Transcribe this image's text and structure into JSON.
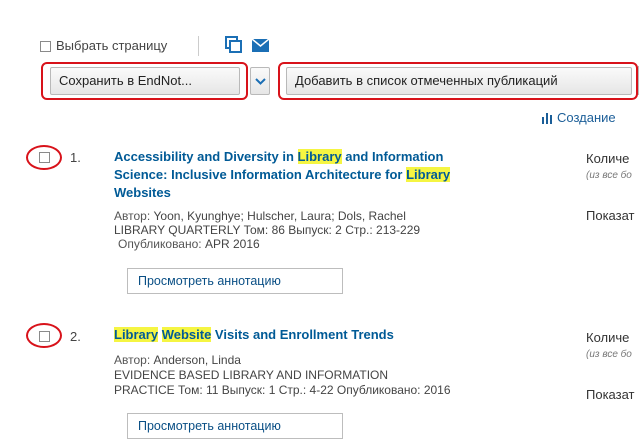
{
  "toolbar": {
    "select_page": "Выбрать страницу",
    "save_label": "Сохранить в EndNot...",
    "add_marked_label": "Добавить в список отмеченных публикаций",
    "create_label": "Создание",
    "icons": [
      "print-icon",
      "email-icon",
      "chevron-down-icon",
      "bar-chart-icon"
    ]
  },
  "results": [
    {
      "index": "1.",
      "title_parts": [
        {
          "t": "Accessibility and Diversity in ",
          "hl": false
        },
        {
          "t": "Library",
          "hl": true
        },
        {
          "t": " and Information",
          "hl": false
        }
      ],
      "title_line2": [
        {
          "t": "Science: Inclusive Information Architecture for ",
          "hl": false
        },
        {
          "t": "Library",
          "hl": true
        }
      ],
      "title_line3": "Websites",
      "authors_label": "Автор:",
      "authors": "Yoon, Kyunghye; Hulscher, Laura; Dols, Rachel",
      "source_line": "LIBRARY QUARTERLY  Том: 86  Выпуск: 2  Стр.: 213-229",
      "published_label": "Опубликовано:",
      "published": "APR 2016",
      "abstract_button": "Просмотреть аннотацию",
      "side_count": "Количе",
      "side_note": "(из все бо",
      "side_show": "Показат"
    },
    {
      "index": "2.",
      "title_parts": [
        {
          "t": "Library",
          "hl": true
        },
        {
          "t": " ",
          "hl": false
        },
        {
          "t": "Website",
          "hl": true
        },
        {
          "t": " Visits and Enrollment Trends",
          "hl": false
        }
      ],
      "authors_label": "Автор:",
      "authors": "Anderson, Linda",
      "source_line1": "EVIDENCE BASED LIBRARY AND INFORMATION",
      "source_line2": "PRACTICE  Том: 11  Выпуск: 1  Стр.: 4-22  Опубликовано: 2016",
      "abstract_button": "Просмотреть аннотацию",
      "side_count": "Количе",
      "side_note": "(из все бо",
      "side_show": "Показат"
    }
  ],
  "colors": {
    "link": "#005a96",
    "highlight": "#f5f542",
    "annotation_red": "#d8121a"
  }
}
